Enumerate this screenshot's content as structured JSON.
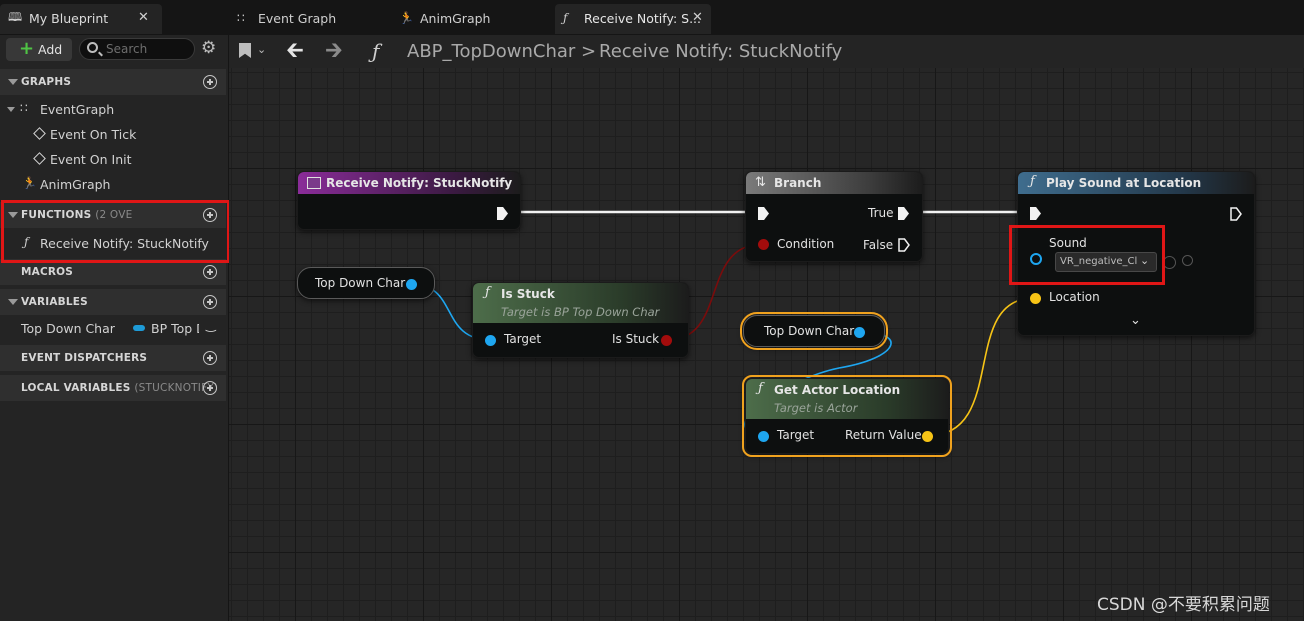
{
  "left_panel": {
    "tab_title": "My Blueprint",
    "add_label": "Add",
    "search_placeholder": "Search",
    "sections": {
      "graphs": "GRAPHS",
      "functions": "FUNCTIONS",
      "functions_sub": "(2 OVE",
      "macros": "MACROS",
      "variables": "VARIABLES",
      "event_dispatchers": "EVENT DISPATCHERS",
      "local_variables": "LOCAL VARIABLES",
      "local_variables_sub": "(STUCKNOTIFY)"
    },
    "graph_items": [
      "EventGraph",
      "Event On Tick",
      "Event On Init",
      "AnimGraph"
    ],
    "function_items": [
      "Receive Notify: StuckNotify"
    ],
    "variable": {
      "name": "Top Down Char",
      "type": "BP Top D",
      "type_color": "#1e9bd7"
    }
  },
  "tabs": [
    {
      "label": "Event Graph",
      "icon": "event-graph-icon"
    },
    {
      "label": "AnimGraph",
      "icon": "anim-graph-icon"
    },
    {
      "label": "Receive Notify: S...",
      "icon": "function-icon",
      "active": true
    }
  ],
  "toolbar": {
    "breadcrumb_root": "ABP_TopDownChar",
    "breadcrumb_sep": ">",
    "breadcrumb_current": "Receive Notify: StuckNotify"
  },
  "nodes": {
    "receive_notify": {
      "title": "Receive Notify: StuckNotify",
      "color": "#8a2c99"
    },
    "branch": {
      "title": "Branch",
      "true_label": "True",
      "false_label": "False",
      "condition_label": "Condition"
    },
    "play_sound": {
      "title": "Play Sound at Location",
      "sound_label": "Sound",
      "sound_value": "VR_negative_Cl",
      "location_label": "Location"
    },
    "top_down_char_1": {
      "label": "Top Down Char"
    },
    "top_down_char_2": {
      "label": "Top Down Char"
    },
    "is_stuck": {
      "title": "Is Stuck",
      "subtitle": "Target is BP Top Down Char",
      "target_label": "Target",
      "output_label": "Is Stuck"
    },
    "get_actor_location": {
      "title": "Get Actor Location",
      "subtitle": "Target is Actor",
      "target_label": "Target",
      "output_label": "Return Value"
    }
  },
  "colors": {
    "object_pin": "#1ea6f0",
    "bool_pin": "#a30c0c",
    "vector_pin": "#f7c416",
    "highlight": "#e01616"
  },
  "watermark": "CSDN @不要积累问题"
}
